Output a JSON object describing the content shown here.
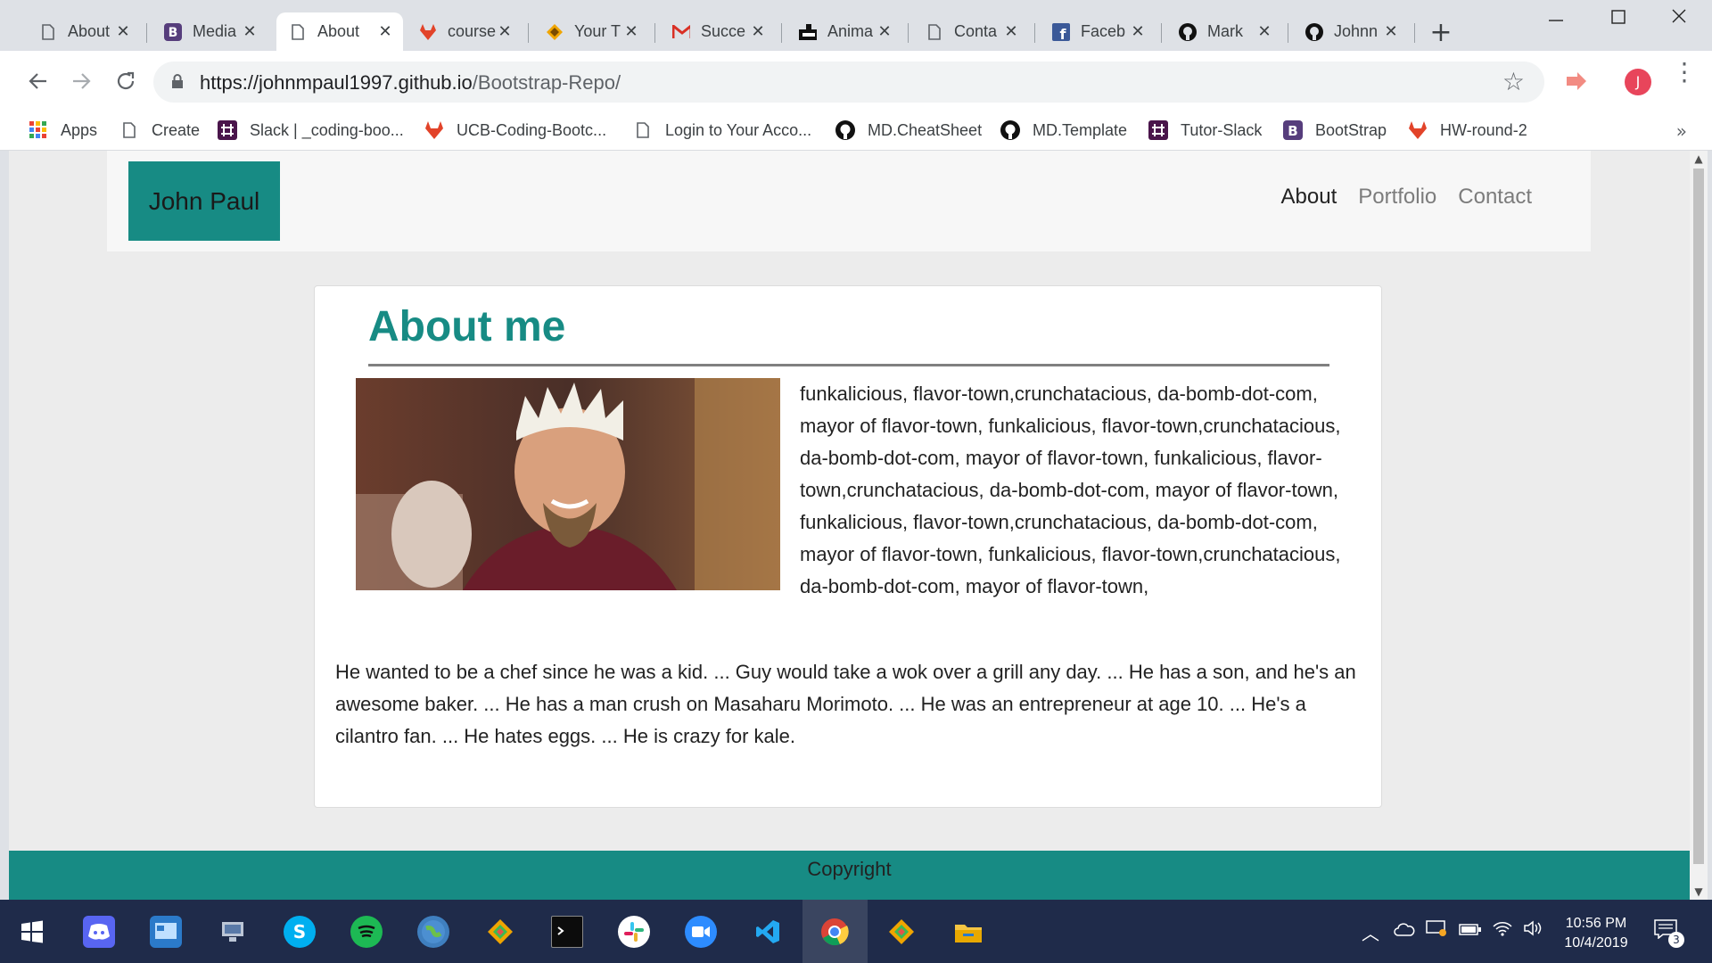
{
  "browser": {
    "tabs": [
      {
        "title": "About",
        "icon": "page-icon",
        "active": false
      },
      {
        "title": "Media",
        "icon": "bootstrap-icon",
        "active": false
      },
      {
        "title": "About",
        "icon": "page-icon",
        "active": true
      },
      {
        "title": "course",
        "icon": "gitlab-icon",
        "active": false
      },
      {
        "title": "Your T",
        "icon": "trello-icon",
        "active": false
      },
      {
        "title": "Succe",
        "icon": "gmail-icon",
        "active": false
      },
      {
        "title": "Anima",
        "icon": "anima-icon",
        "active": false
      },
      {
        "title": "Conta",
        "icon": "page-icon",
        "active": false
      },
      {
        "title": "Faceb",
        "icon": "facebook-icon",
        "active": false
      },
      {
        "title": "Mark",
        "icon": "github-icon",
        "active": false
      },
      {
        "title": "Johnn",
        "icon": "github-icon",
        "active": false
      }
    ],
    "url_host": "https://johnmpaul1997.github.io",
    "url_path": "/Bootstrap-Repo/",
    "profile_initial": "J",
    "bookmarks": [
      {
        "label": "Apps",
        "icon": "apps-grid-icon"
      },
      {
        "label": "Create",
        "icon": "page-icon"
      },
      {
        "label": "Slack | _coding-boo...",
        "icon": "slack-icon"
      },
      {
        "label": "UCB-Coding-Bootc...",
        "icon": "gitlab-icon"
      },
      {
        "label": "Login to Your Acco...",
        "icon": "page-icon"
      },
      {
        "label": "MD.CheatSheet",
        "icon": "github-icon"
      },
      {
        "label": "MD.Template",
        "icon": "github-icon"
      },
      {
        "label": "Tutor-Slack",
        "icon": "slack-icon"
      },
      {
        "label": "BootStrap",
        "icon": "bootstrap-icon"
      },
      {
        "label": "HW-round-2",
        "icon": "gitlab-icon"
      }
    ],
    "bookmarks_overflow": "»"
  },
  "site": {
    "brand": "John Paul",
    "nav": [
      {
        "label": "About",
        "active": true
      },
      {
        "label": "Portfolio",
        "active": false
      },
      {
        "label": "Contact",
        "active": false
      }
    ],
    "heading": "About me",
    "paragraph1": "funkalicious, flavor-town,crunchatacious, da-bomb-dot-com, mayor of flavor-town, funkalicious, flavor-town,crunchatacious, da-bomb-dot-com, mayor of flavor-town, funkalicious, flavor-town,crunchatacious, da-bomb-dot-com, mayor of flavor-town, funkalicious, flavor-town,crunchatacious, da-bomb-dot-com, mayor of flavor-town, funkalicious, flavor-town,crunchatacious, da-bomb-dot-com, mayor of flavor-town,",
    "paragraph2": "He wanted to be a chef since he was a kid. ... Guy would take a wok over a grill any day. ... He has a son, and he's an awesome baker. ... He has a man crush on Masaharu Morimoto. ... He was an entrepreneur at age 10. ... He's a cilantro fan. ... He hates eggs. ... He is crazy for kale.",
    "footer": "Copyright",
    "accent_color": "#178b84"
  },
  "taskbar": {
    "apps": [
      "windows-start-icon",
      "discord-icon",
      "control-panel-icon",
      "network-icon",
      "skype-icon",
      "spotify-icon",
      "globe-icon",
      "git-kraken-icon",
      "terminal-icon",
      "slack-icon",
      "zoom-icon",
      "vscode-icon",
      "chrome-icon",
      "git-kraken-icon",
      "file-explorer-icon"
    ],
    "time": "10:56 PM",
    "date": "10/4/2019",
    "notification_count": "3"
  }
}
